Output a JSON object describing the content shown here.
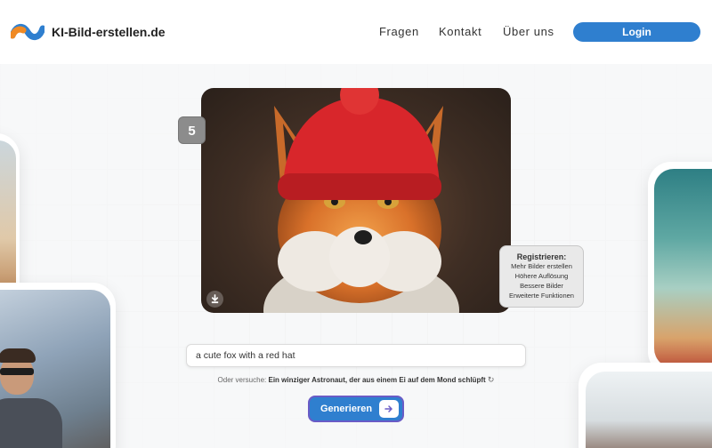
{
  "header": {
    "brand": "KI-Bild-erstellen.de",
    "nav": [
      "Fragen",
      "Kontakt",
      "Über uns"
    ],
    "login_label": "Login"
  },
  "image_panel": {
    "count_badge": "5",
    "register": {
      "title": "Registrieren:",
      "items": [
        "Mehr Bilder erstellen",
        "Höhere Auflösung",
        "Bessere Bilder",
        "Erweiterte Funktionen"
      ]
    }
  },
  "prompt": {
    "value": "a cute fox with a red hat",
    "suggestion_prefix": "Oder versuche:",
    "suggestion_text": "Ein winziger Astronaut, der aus einem Ei auf dem Mond schlüpft"
  },
  "generate_label": "Generieren",
  "colors": {
    "accent": "#2f7fcf",
    "button_border": "#6a5bc6",
    "register_bg": "#e9e9e9",
    "hat": "#d8262b"
  },
  "icons": [
    "logo-icon",
    "download-icon",
    "refresh-icon",
    "arrow-right-icon"
  ]
}
